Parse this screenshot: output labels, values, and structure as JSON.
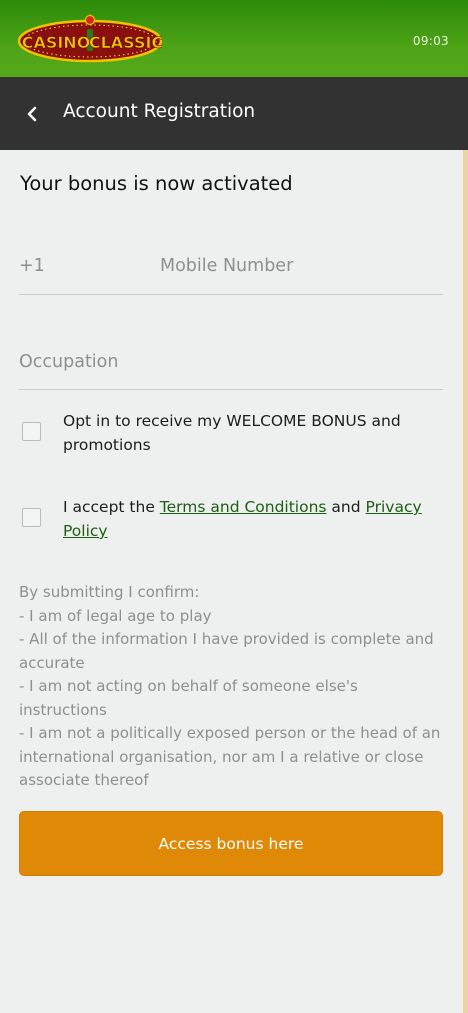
{
  "status_bar": {
    "time": "09:03",
    "logo_text_left": "CASINO",
    "logo_text_right": "CLASSIC"
  },
  "header": {
    "back_icon": "chevron-left-icon",
    "title": "Account Registration"
  },
  "form": {
    "headline": "Your bonus is now activated",
    "phone_prefix": "+1",
    "mobile_placeholder": "Mobile Number",
    "occupation_placeholder": "Occupation",
    "opt_in_label": "Opt in to receive my WELCOME BONUS and promotions",
    "terms": {
      "prefix": "I accept the ",
      "terms_link": "Terms and Conditions",
      "connector": " and ",
      "privacy_link": "Privacy Policy"
    },
    "disclaimer": [
      "By submitting I confirm:",
      "- I am of legal age to play",
      "- All of the information I have provided is complete and accurate",
      "- I am not acting on behalf of someone else's instructions",
      "- I am not a politically exposed person or the head of an international organisation, nor am I a relative or close associate thereof"
    ],
    "submit_label": "Access bonus here"
  },
  "colors": {
    "status_bar_green": "#4ea317",
    "app_bar": "#333232",
    "accent_orange": "#e08906",
    "link_green": "#1d5e14",
    "background": "#eef0ef"
  }
}
